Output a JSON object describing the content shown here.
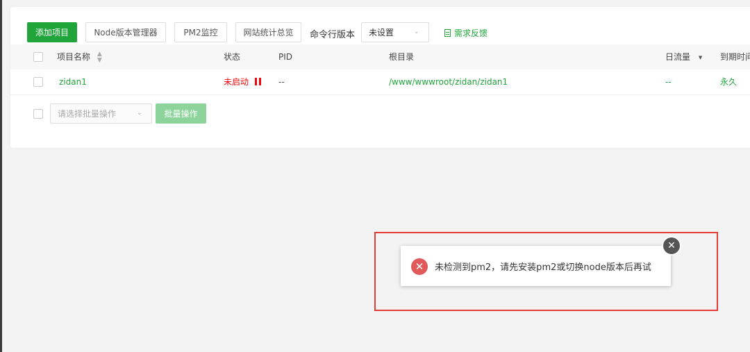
{
  "toolbar": {
    "add_project": "添加项目",
    "node_manager": "Node版本管理器",
    "pm2_monitor": "PM2监控",
    "site_stats": "网站统计总览",
    "cmd_version_label": "命令行版本",
    "cmd_version_value": "未设置",
    "feedback": "需求反馈"
  },
  "table": {
    "headers": {
      "name": "项目名称",
      "status": "状态",
      "pid": "PID",
      "root": "根目录",
      "traffic": "日流量",
      "expire": "到期时间"
    },
    "rows": [
      {
        "name": "zidan1",
        "status": "未启动",
        "pid": "--",
        "root": "/www/wwwroot/zidan/zidan1",
        "traffic": "--",
        "expire": "永久"
      }
    ]
  },
  "batch": {
    "select_placeholder": "请选择批量操作",
    "button": "批量操作"
  },
  "toast": {
    "message": "未检测到pm2，请先安装pm2或切换node版本后再试"
  },
  "colors": {
    "accent": "#20a53a",
    "error": "#ef0808",
    "highlight_border": "#e53935"
  }
}
